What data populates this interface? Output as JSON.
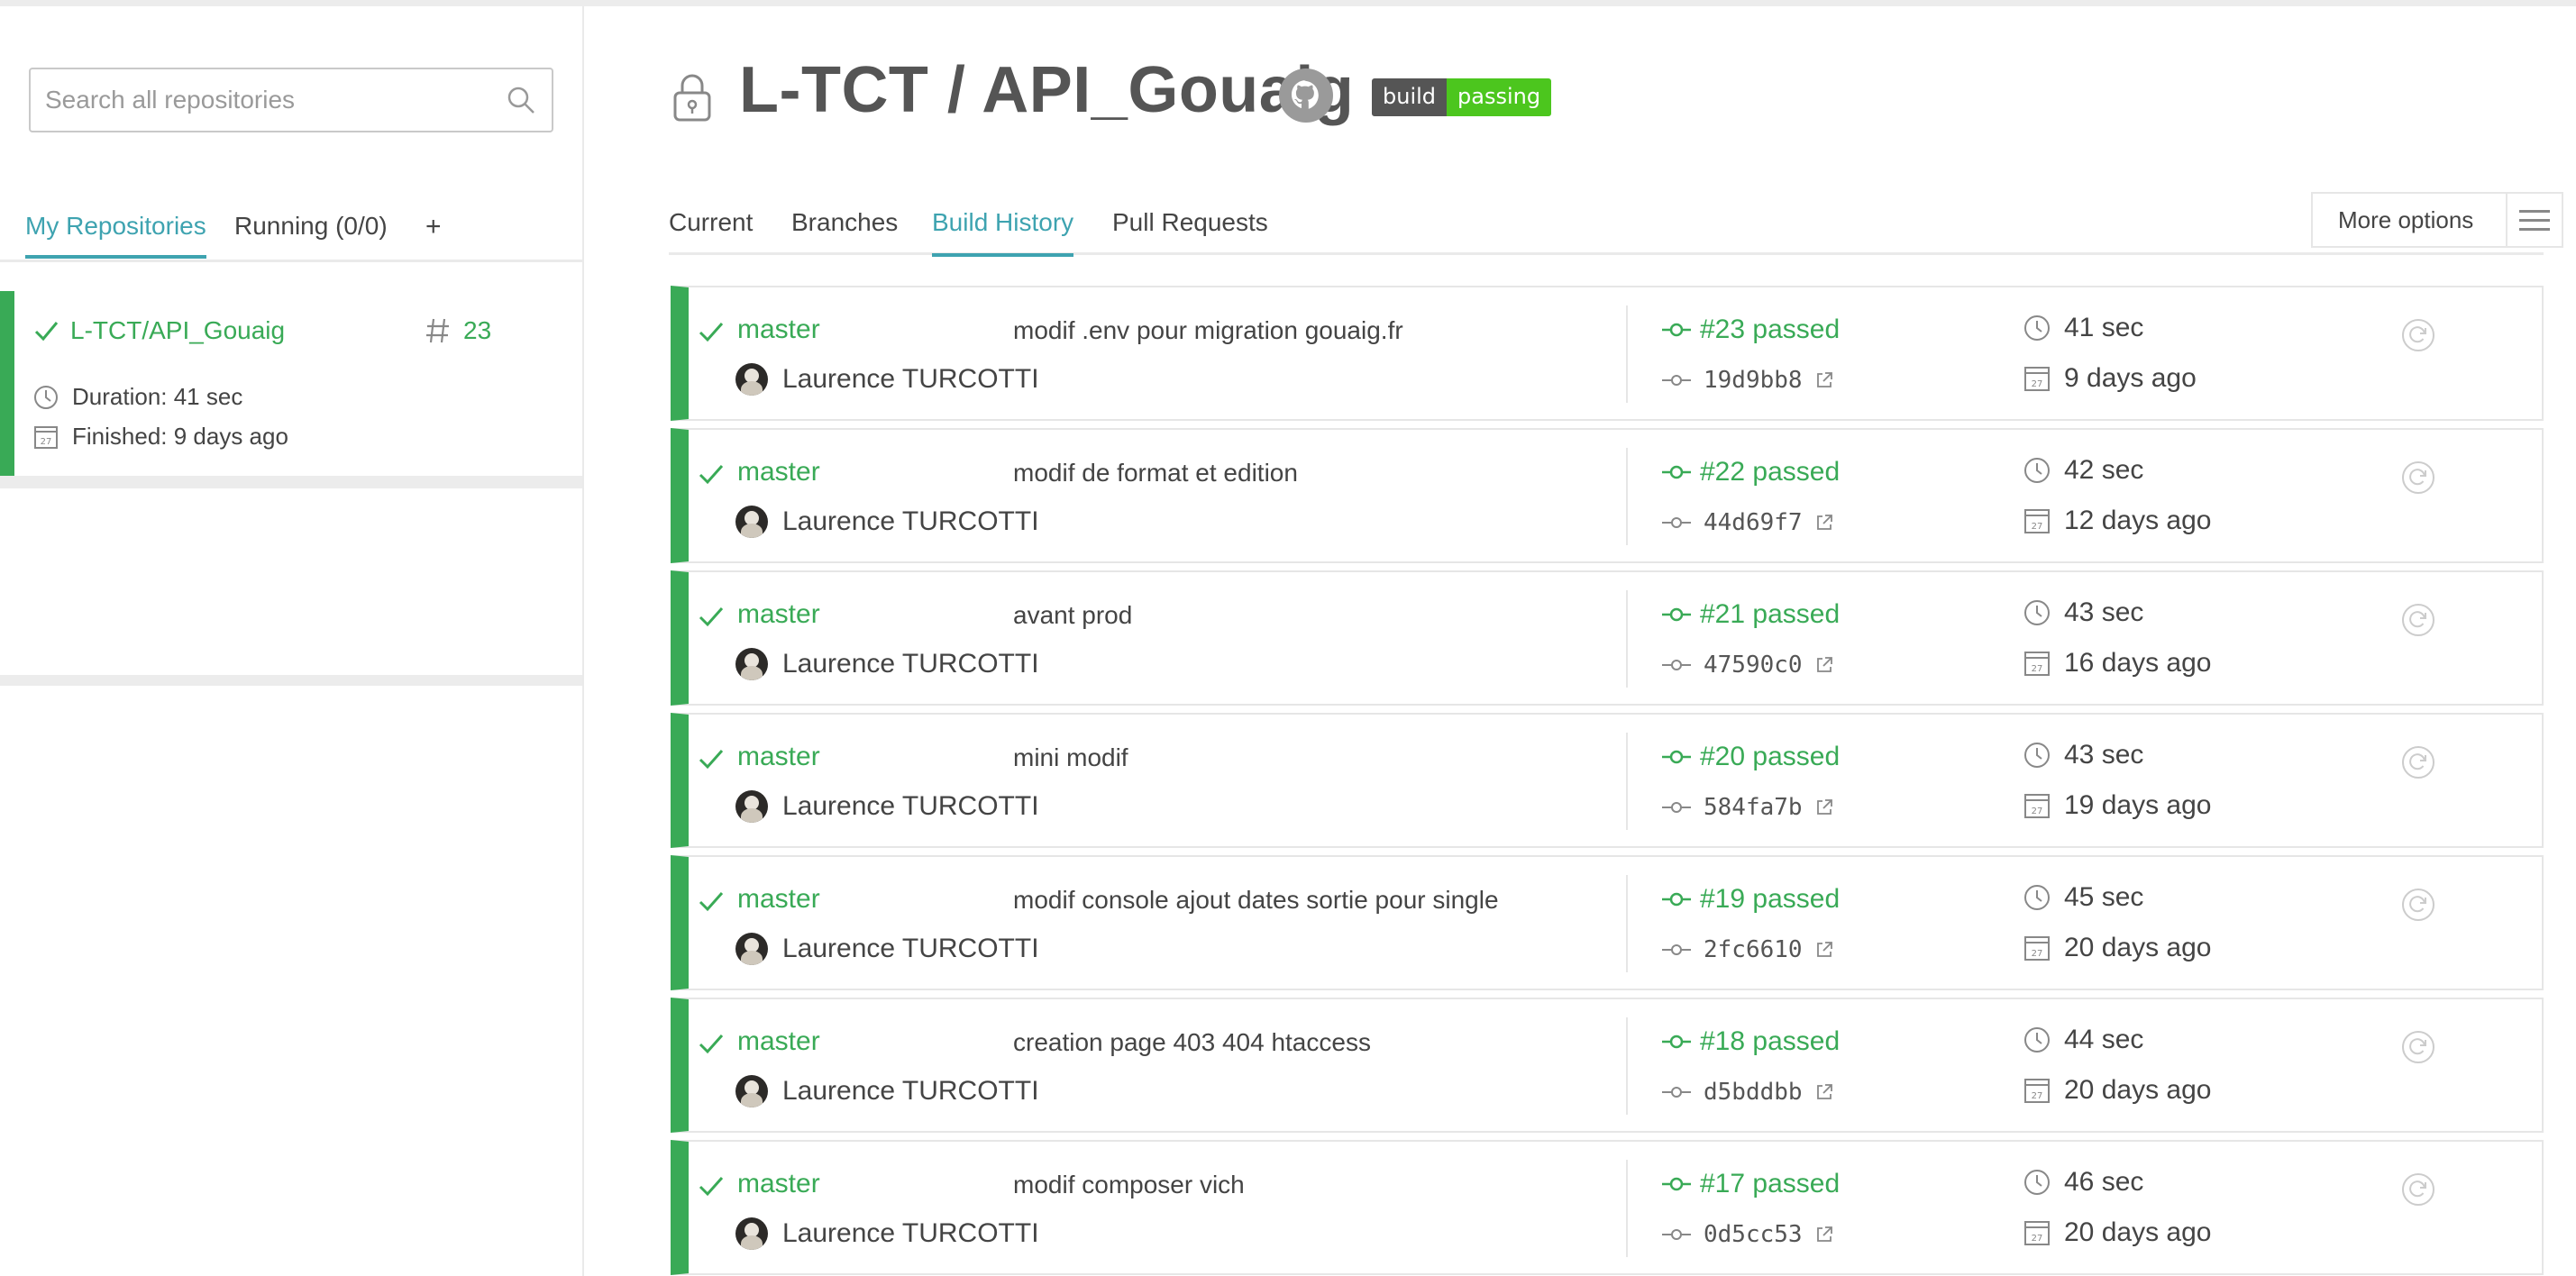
{
  "sidebar": {
    "search_placeholder": "Search all repositories",
    "tabs": [
      {
        "label": "My Repositories",
        "active": true
      },
      {
        "label": "Running (0/0)",
        "active": false
      },
      {
        "label": "+",
        "active": false
      }
    ],
    "repo": {
      "name": "L-TCT/API_Gouaig",
      "build_number": "23",
      "duration": "Duration: 41 sec",
      "finished": "Finished: 9 days ago",
      "status_color": "#39aa56"
    }
  },
  "header": {
    "title": "L-TCT / API_Gouaig",
    "badge_left": "build",
    "badge_right": "passing"
  },
  "tabs": [
    {
      "label": "Current",
      "active": false
    },
    {
      "label": "Branches",
      "active": false
    },
    {
      "label": "Build History",
      "active": true
    },
    {
      "label": "Pull Requests",
      "active": false
    }
  ],
  "more_options": "More options",
  "colors": {
    "passed": "#39aa56",
    "accent": "#3ea3b0"
  },
  "builds": [
    {
      "branch": "master",
      "message": "modif .env pour migration gouaig.fr",
      "author": "Laurence TURCOTTI",
      "number": "#23 passed",
      "sha": "19d9bb8",
      "duration": "41 sec",
      "ago": "9 days ago"
    },
    {
      "branch": "master",
      "message": "modif de format et edition",
      "author": "Laurence TURCOTTI",
      "number": "#22 passed",
      "sha": "44d69f7",
      "duration": "42 sec",
      "ago": "12 days ago"
    },
    {
      "branch": "master",
      "message": "avant prod",
      "author": "Laurence TURCOTTI",
      "number": "#21 passed",
      "sha": "47590c0",
      "duration": "43 sec",
      "ago": "16 days ago"
    },
    {
      "branch": "master",
      "message": "mini modif",
      "author": "Laurence TURCOTTI",
      "number": "#20 passed",
      "sha": "584fa7b",
      "duration": "43 sec",
      "ago": "19 days ago"
    },
    {
      "branch": "master",
      "message": "modif console ajout dates sortie pour single",
      "author": "Laurence TURCOTTI",
      "number": "#19 passed",
      "sha": "2fc6610",
      "duration": "45 sec",
      "ago": "20 days ago"
    },
    {
      "branch": "master",
      "message": "creation page 403 404 htaccess",
      "author": "Laurence TURCOTTI",
      "number": "#18 passed",
      "sha": "d5bddbb",
      "duration": "44 sec",
      "ago": "20 days ago"
    },
    {
      "branch": "master",
      "message": "modif composer vich",
      "author": "Laurence TURCOTTI",
      "number": "#17 passed",
      "sha": "0d5cc53",
      "duration": "46 sec",
      "ago": "20 days ago"
    }
  ]
}
